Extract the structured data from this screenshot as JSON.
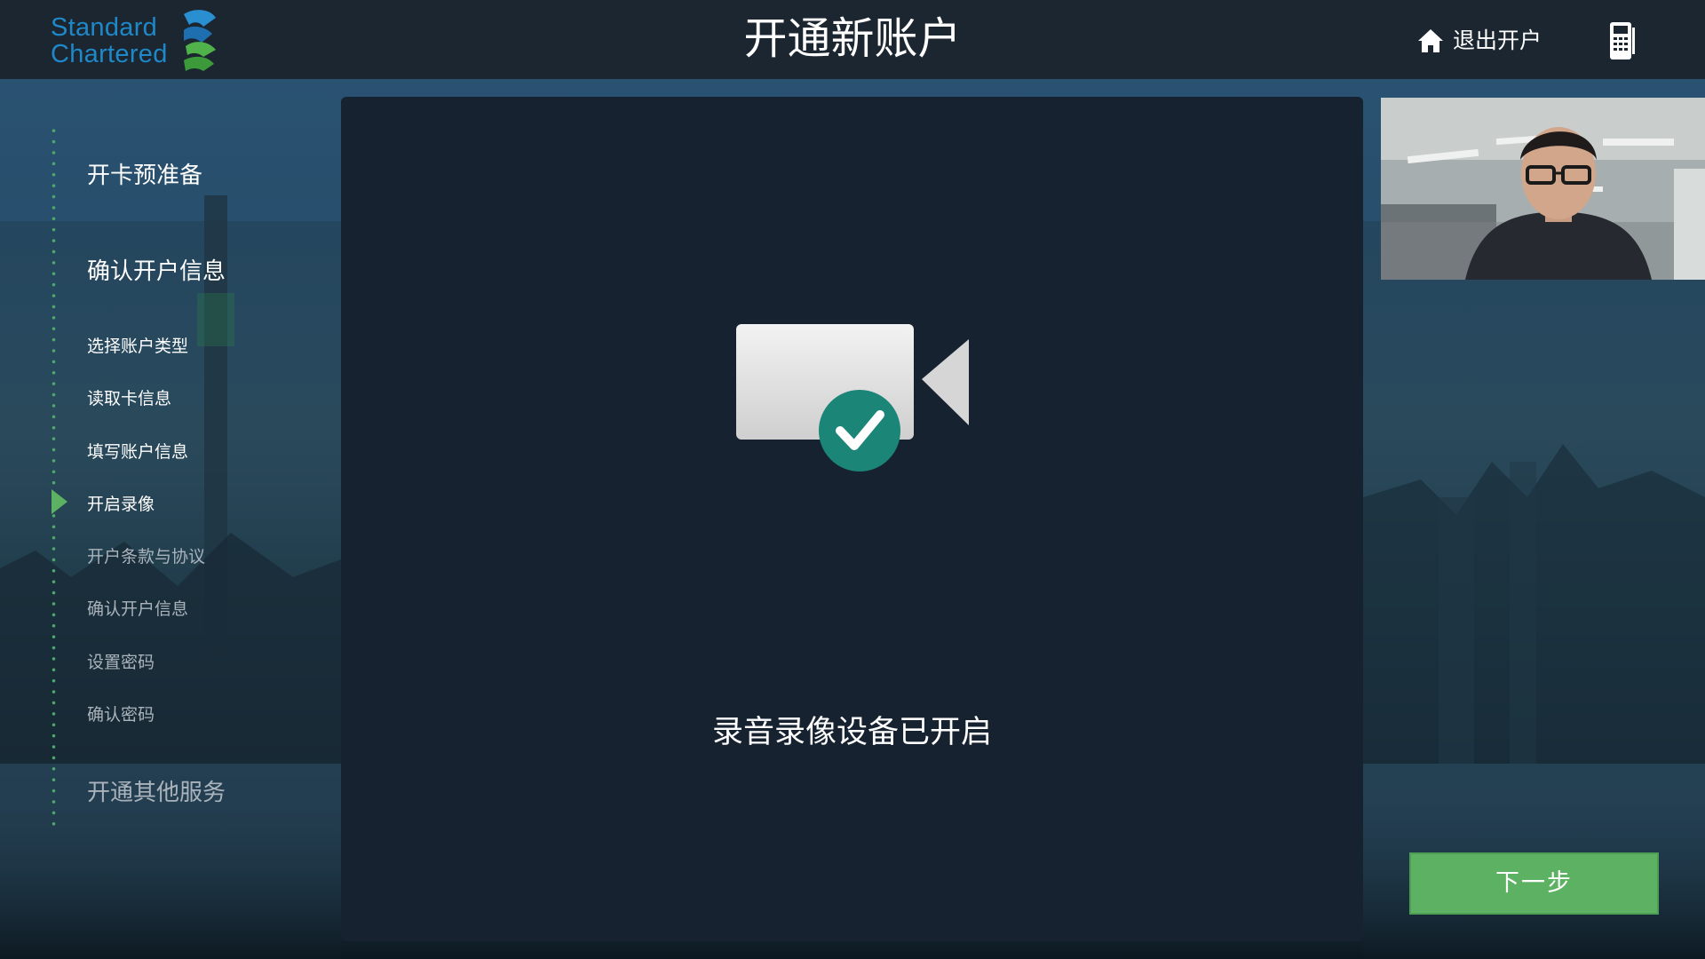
{
  "header": {
    "brand_line1": "Standard",
    "brand_line2": "Chartered",
    "title": "开通新账户",
    "exit_label": "退出开户"
  },
  "sidebar": {
    "steps": [
      {
        "label": "开卡预准备",
        "level": "major",
        "state": "done"
      },
      {
        "label": "确认开户信息",
        "level": "major",
        "state": "active"
      },
      {
        "label": "选择账户类型",
        "level": "minor",
        "state": "done"
      },
      {
        "label": "读取卡信息",
        "level": "minor",
        "state": "done"
      },
      {
        "label": "填写账户信息",
        "level": "minor",
        "state": "done"
      },
      {
        "label": "开启录像",
        "level": "minor",
        "state": "current"
      },
      {
        "label": "开户条款与协议",
        "level": "minor",
        "state": "pending"
      },
      {
        "label": "确认开户信息",
        "level": "minor",
        "state": "pending"
      },
      {
        "label": "设置密码",
        "level": "minor",
        "state": "pending"
      },
      {
        "label": "确认密码",
        "level": "minor",
        "state": "pending"
      },
      {
        "label": "开通其他服务",
        "level": "major",
        "state": "pending"
      }
    ]
  },
  "main": {
    "status_icon": "video-camera-check-icon",
    "status_text": "录音录像设备已开启"
  },
  "footer": {
    "next_label": "下一步"
  },
  "colors": {
    "accent_green": "#5cb162",
    "check_teal": "#1b8577",
    "brand_blue": "#1e88c8",
    "panel_bg": "#172230",
    "header_bg": "#1c2631"
  }
}
